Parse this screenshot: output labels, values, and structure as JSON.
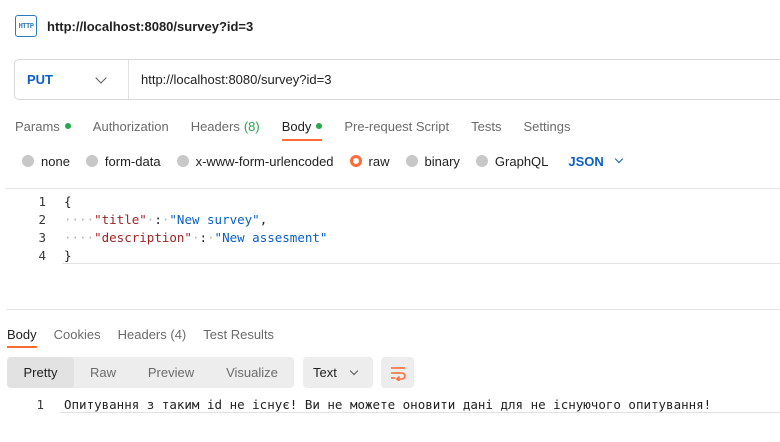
{
  "header": {
    "icon_label": "HTTP",
    "title": "http://localhost:8080/survey?id=3"
  },
  "request": {
    "method": "PUT",
    "url": "http://localhost:8080/survey?id=3"
  },
  "request_tabs": {
    "params": "Params",
    "authorization": "Authorization",
    "headers": "Headers",
    "headers_count": "(8)",
    "body": "Body",
    "pre_request": "Pre-request Script",
    "tests": "Tests",
    "settings": "Settings"
  },
  "body_types": {
    "none": "none",
    "form_data": "form-data",
    "urlencoded": "x-www-form-urlencoded",
    "raw": "raw",
    "binary": "binary",
    "graphql": "GraphQL",
    "language": "JSON"
  },
  "editor": {
    "line_numbers": [
      "1",
      "2",
      "3",
      "4"
    ],
    "open_brace": "{",
    "close_brace": "}",
    "key1": "\"title\"",
    "val1": "\"New survey\"",
    "key2": "\"description\"",
    "val2": "\"New assesment\""
  },
  "response_tabs": {
    "body": "Body",
    "cookies": "Cookies",
    "headers": "Headers (4)",
    "test_results": "Test Results"
  },
  "response_view": {
    "pretty": "Pretty",
    "raw": "Raw",
    "preview": "Preview",
    "visualize": "Visualize",
    "format": "Text"
  },
  "response_body": {
    "line_number": "1",
    "text": "Опитування з таким id не існує! Ви не можете оновити дані для не існуючого опитування!"
  },
  "colors": {
    "accent": "#ff6c37",
    "method_blue": "#0b5ec6",
    "indicator_green": "#27a84a"
  }
}
